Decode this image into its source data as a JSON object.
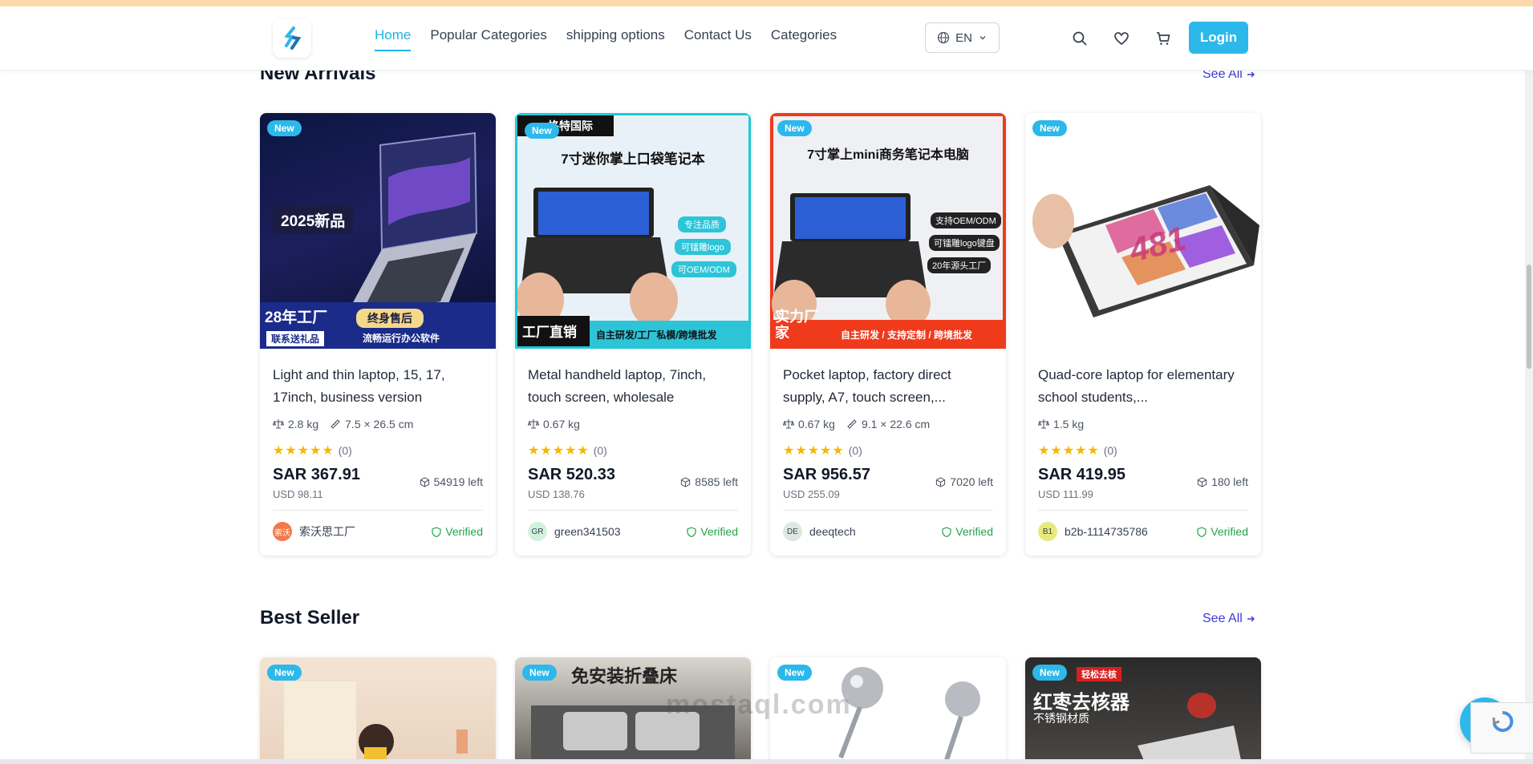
{
  "nav": {
    "links": [
      "Home",
      "Popular Categories",
      "shipping options",
      "Contact Us",
      "Categories"
    ],
    "language": "EN",
    "login_label": "Login"
  },
  "sections": {
    "new_arrivals": {
      "title": "New Arrivals",
      "see_all": "See All"
    },
    "best_seller": {
      "title": "Best Seller",
      "see_all": "See All"
    }
  },
  "badge_label": "New",
  "verified_label": "Verified",
  "products": [
    {
      "title": "Light and thin laptop, 15, 17, 17inch, business version",
      "weight": "2.8 kg",
      "dimensions": "7.5 × 26.5 cm",
      "reviews": "(0)",
      "price": "SAR 367.91",
      "usd": "USD 98.11",
      "stock": "54919 left",
      "seller": "索沃思工厂",
      "seller_initials": "索沃",
      "image_text": {
        "a": "2025新品",
        "b": "28年工厂",
        "c": "终身售后",
        "d": "联系送礼品",
        "e": "流畅运行办公软件"
      }
    },
    {
      "title": "Metal handheld laptop, 7inch, touch screen, wholesale",
      "weight": "0.67 kg",
      "dimensions": "",
      "reviews": "(0)",
      "price": "SAR 520.33",
      "usd": "USD 138.76",
      "stock": "8585 left",
      "seller": "green341503",
      "seller_initials": "GR",
      "image_text": {
        "a": "7寸迷你掌上口袋笔记本",
        "b": "工厂直销",
        "c": "自主研发/工厂私模/跨境批发",
        "d": "专注品质",
        "e": "可镭雕logo",
        "f": "可OEM/ODM",
        "g": "恪特国际"
      }
    },
    {
      "title": "Pocket laptop, factory direct supply, A7, touch screen,...",
      "weight": "0.67 kg",
      "dimensions": "9.1 × 22.6 cm",
      "reviews": "(0)",
      "price": "SAR 956.57",
      "usd": "USD 255.09",
      "stock": "7020 left",
      "seller": "deeqtech",
      "seller_initials": "DE",
      "image_text": {
        "a": "7寸掌上mini商务笔记本电脑",
        "b": "实力厂家",
        "c": "自主研发 / 支持定制 / 跨境批发",
        "d": "支持OEM/ODM",
        "e": "可镭雕logo键盘",
        "f": "20年源头工厂"
      }
    },
    {
      "title": "Quad-core laptop for elementary school students,...",
      "weight": "1.5 kg",
      "dimensions": "",
      "reviews": "(0)",
      "price": "SAR 419.95",
      "usd": "USD 111.99",
      "stock": "180 left",
      "seller": "b2b-1114735786",
      "seller_initials": "B1",
      "image_text": {
        "a": "481"
      }
    }
  ],
  "best_seller_images": {
    "b": "免安装折叠床",
    "d_title": "红枣去核器",
    "d_sub": "不锈钢材质",
    "d_tag": "轻松去核"
  },
  "watermark": "mostaql.com",
  "colors": {
    "accent": "#2cb8ea",
    "link": "#3b3bd6",
    "verified": "#22a34a",
    "star": "#f5b800"
  }
}
